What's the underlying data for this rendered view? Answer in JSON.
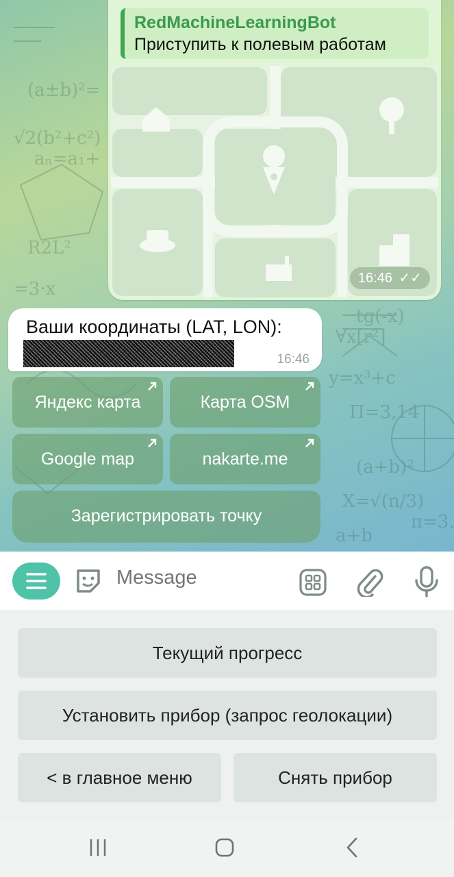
{
  "map_message": {
    "reply_author": "RedMachineLearningBot",
    "reply_text": "Приступить к полевым работам",
    "time": "16:46"
  },
  "coord_message": {
    "text": "Ваши координаты (LAT, LON):",
    "time": "16:46"
  },
  "inline_keyboard": {
    "yandex": "Яндекс карта",
    "osm": "Карта OSM",
    "google": "Google map",
    "nakarte": "nakarte.me",
    "register": "Зарегистрировать точку"
  },
  "input": {
    "placeholder": "Message"
  },
  "reply_keyboard": {
    "progress": "Текущий прогресс",
    "install": "Установить прибор (запрос геолокации)",
    "main_menu": "< в главное меню",
    "remove": "Снять прибор"
  },
  "colors": {
    "accent": "#4fc3a7",
    "bot_name": "#3a9a4d",
    "bubble_out": "#dff5d6"
  }
}
